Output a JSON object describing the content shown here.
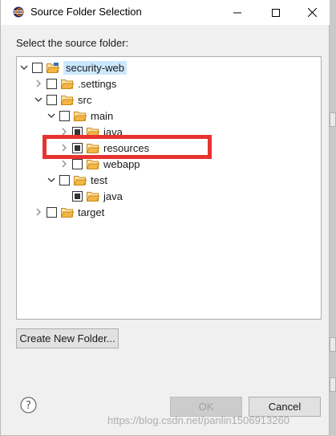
{
  "window": {
    "title": "Source Folder Selection",
    "minimize_glyph": "—",
    "maximize_glyph": "☐",
    "close_glyph": "✕"
  },
  "prompt": "Select the source folder:",
  "tree": [
    {
      "label": "security-web",
      "expanded": true,
      "checked": "unchecked",
      "selected": true,
      "icon": "project-folder-icon"
    },
    {
      "label": ".settings",
      "expanded": false,
      "checked": "unchecked",
      "icon": "folder-icon"
    },
    {
      "label": "src",
      "expanded": true,
      "checked": "unchecked",
      "icon": "folder-icon"
    },
    {
      "label": "main",
      "expanded": true,
      "checked": "unchecked",
      "icon": "folder-icon"
    },
    {
      "label": "java",
      "expanded": false,
      "checked": "mixed",
      "icon": "folder-icon"
    },
    {
      "label": "resources",
      "expanded": false,
      "checked": "mixed",
      "icon": "folder-icon"
    },
    {
      "label": "webapp",
      "expanded": false,
      "checked": "unchecked",
      "icon": "folder-icon"
    },
    {
      "label": "test",
      "expanded": true,
      "checked": "unchecked",
      "icon": "folder-icon"
    },
    {
      "label": "java",
      "expanded": null,
      "checked": "mixed",
      "icon": "folder-icon"
    },
    {
      "label": "target",
      "expanded": false,
      "checked": "unchecked",
      "icon": "folder-icon"
    }
  ],
  "buttons": {
    "create_folder": "Create New Folder...",
    "ok": "OK",
    "cancel": "Cancel"
  },
  "watermark": "https://blog.csdn.net/panlin1506913260",
  "colors": {
    "highlight_box": "#e8332f",
    "selection": "#cce8ff",
    "folder": "#f3b644"
  }
}
